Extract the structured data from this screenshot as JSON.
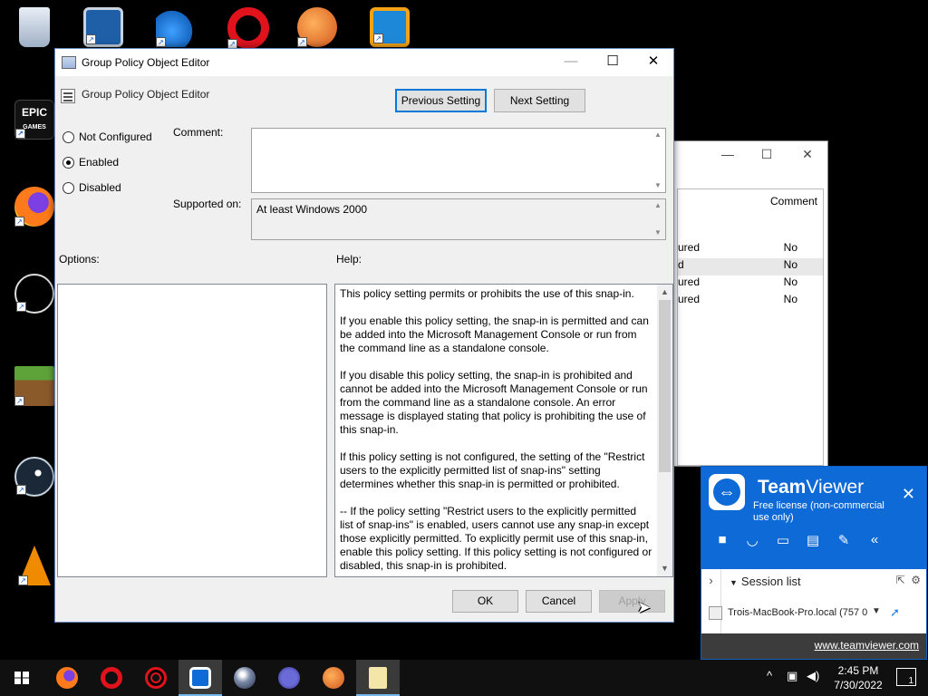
{
  "desktop": {
    "icons": [
      {
        "label": "Recycle B",
        "name": "recycle-bin"
      },
      {
        "label": "",
        "name": "virtualbox"
      },
      {
        "label": "",
        "name": "dolphin"
      },
      {
        "label": "",
        "name": "opera"
      },
      {
        "label": "",
        "name": "paint-app"
      },
      {
        "label": "",
        "name": "vmware"
      },
      {
        "label": "Epic Gam Launche",
        "name": "epic-games"
      },
      {
        "label": "Firefox",
        "name": "firefox"
      },
      {
        "label": "Super Sma Flash 2 Be",
        "name": "super-smash-flash"
      },
      {
        "label": "Minecraf Launche",
        "name": "minecraft"
      },
      {
        "label": "Steam",
        "name": "steam"
      },
      {
        "label": "VLC medi player",
        "name": "vlc"
      }
    ],
    "epic_logo": "EPIC\nGAMES"
  },
  "bg_window": {
    "column_header": "Comment",
    "rows": [
      {
        "a": "ured",
        "b": "No"
      },
      {
        "a": "d",
        "b": "No"
      },
      {
        "a": "ured",
        "b": "No"
      },
      {
        "a": "ured",
        "b": "No"
      }
    ]
  },
  "dialog": {
    "title": "Group Policy Object Editor",
    "header_text": "Group Policy Object Editor",
    "prev_button": "Previous Setting",
    "next_button": "Next Setting",
    "radios": {
      "not_configured": "Not Configured",
      "enabled": "Enabled",
      "disabled": "Disabled",
      "selected": "Enabled"
    },
    "comment_label": "Comment:",
    "comment_value": "",
    "supported_label": "Supported on:",
    "supported_value": "At least Windows 2000",
    "options_label": "Options:",
    "help_label": "Help:",
    "help_paragraphs": [
      "This policy setting permits or prohibits the use of this snap-in.",
      "If you enable this policy setting, the snap-in is permitted and can be added into the Microsoft Management Console or run from the command line as a standalone console.",
      "If you disable this policy setting, the snap-in is prohibited and cannot be added into the Microsoft Management Console or run from the command line as a standalone console. An error message is displayed stating that policy is prohibiting the use of this snap-in.",
      "If this policy setting is not configured, the setting of the \"Restrict users to the explicitly permitted list of snap-ins\" setting determines whether this snap-in is permitted or prohibited.",
      "--  If the policy setting \"Restrict users to the explicitly permitted list of snap-ins\" is enabled, users cannot use any snap-in except those explicitly permitted. To explicitly permit use of this snap-in, enable this policy setting. If this policy setting is not configured or disabled, this snap-in is prohibited."
    ],
    "ok_button": "OK",
    "cancel_button": "Cancel",
    "apply_button": "Apply"
  },
  "teamviewer": {
    "brand_bold": "Team",
    "brand_rest": "Viewer",
    "license": "Free license (non-commercial use only)",
    "session_list": "Session list",
    "session_item": "Trois-MacBook-Pro.local (757 0",
    "footer_link": "www.teamviewer.com"
  },
  "taskbar": {
    "time": "2:45 PM",
    "date": "7/30/2022",
    "notifications": "1"
  },
  "colors": {
    "accent": "#0078d7",
    "teamviewer": "#0e6ad6",
    "taskbar": "#101010"
  }
}
